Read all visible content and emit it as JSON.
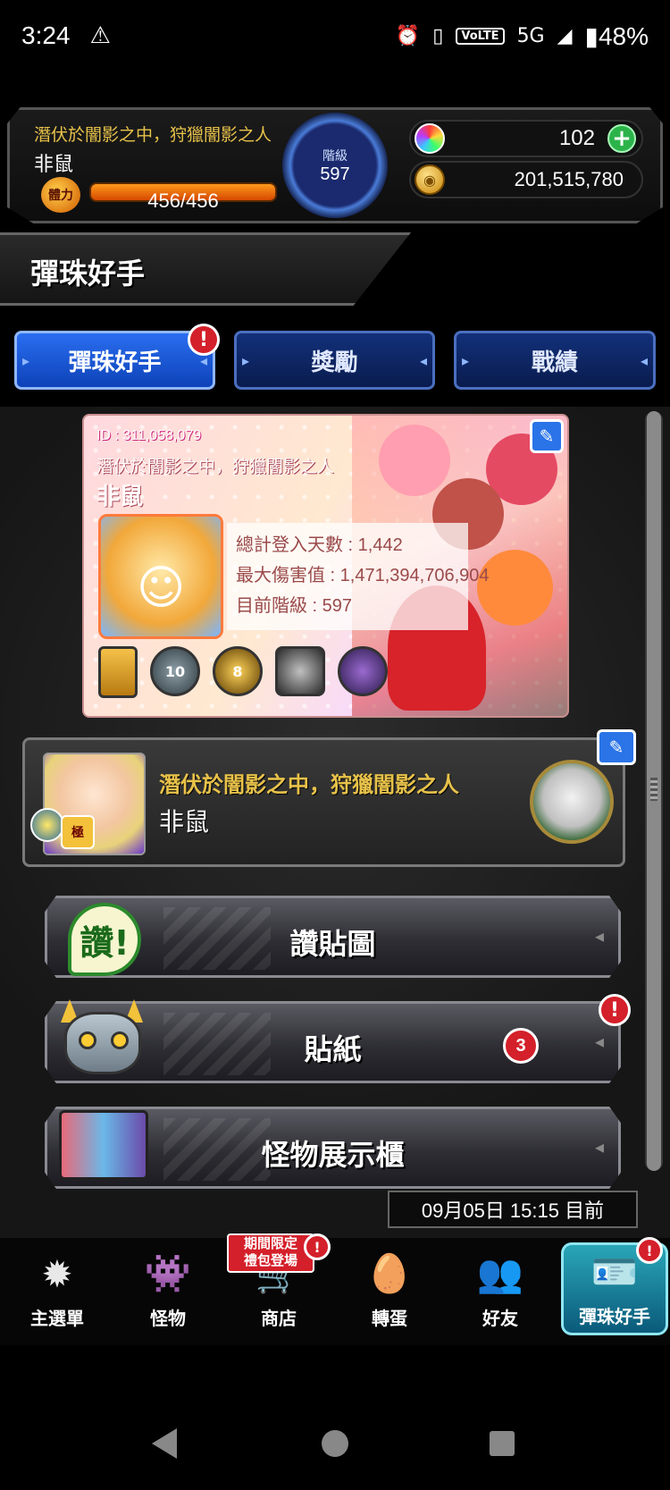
{
  "status_bar": {
    "time": "3:24",
    "network": "5G",
    "volte": "VoLTE",
    "battery": "48%"
  },
  "header": {
    "title": "潛伏於闇影之中，狩獵闇影之人",
    "name": "非鼠",
    "stamina_icon": "體力",
    "stamina": "456/456",
    "rank_label": "階級",
    "rank": "597",
    "orbs": "102",
    "gold": "201,515,780"
  },
  "section_title": "彈珠好手",
  "tabs": [
    {
      "label": "彈珠好手",
      "active": true,
      "alert": "!"
    },
    {
      "label": "獎勵"
    },
    {
      "label": "戰績"
    }
  ],
  "profile_card": {
    "id": "ID : 311,058,079",
    "title": "潛伏於闇影之中，狩獵闇影之人",
    "name": "非鼠",
    "stats": [
      "總計登入天數 : 1,442",
      "最大傷害值 : 1,471,394,706,904",
      "目前階級 : 597"
    ],
    "medals": [
      "",
      "10",
      "8",
      "",
      ""
    ]
  },
  "player_strip": {
    "title": "潛伏於闇影之中，狩獵闇影之人",
    "name": "非鼠",
    "badge": "極"
  },
  "menu": [
    {
      "label": "讚貼圖",
      "icon_text": "讚!"
    },
    {
      "label": "貼紙",
      "count": "3",
      "alert": "!"
    },
    {
      "label": "怪物展示櫃"
    }
  ],
  "timestamp": "09月05日 15:15 目前",
  "bottom_nav": {
    "promo": "期間限定\n禮包登場",
    "items": [
      {
        "label": "主選單",
        "icon": "main-menu-icon"
      },
      {
        "label": "怪物",
        "icon": "monster-icon"
      },
      {
        "label": "商店",
        "icon": "shop-cart-icon"
      },
      {
        "label": "轉蛋",
        "icon": "gacha-egg-icon"
      },
      {
        "label": "好友",
        "icon": "friends-icon"
      },
      {
        "label": "彈珠好手",
        "icon": "profile-card-icon",
        "active": true
      }
    ]
  },
  "colors": {
    "accent_gold": "#e8c24a",
    "tab_blue": "#2a6ef0",
    "alert_red": "#d4202a",
    "nav_active": "#2aa6b8"
  }
}
